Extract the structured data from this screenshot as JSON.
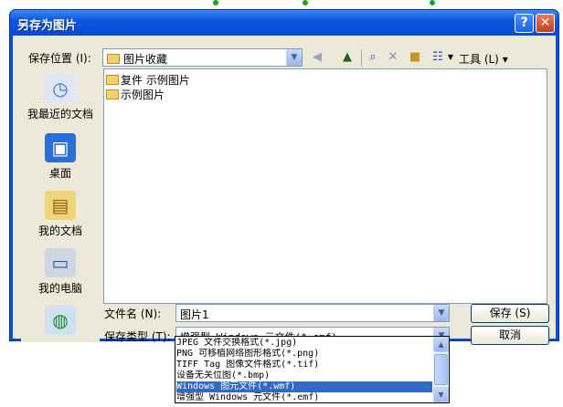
{
  "dialog": {
    "title": "另存为图片",
    "help_icon": "?",
    "close_icon": "✕"
  },
  "toolbar": {
    "save_in_label": "保存位置 (I):",
    "location": "图片收藏",
    "tools_label": "工具 (L)",
    "icons": [
      "back-icon",
      "up-folder-icon",
      "search-web-icon",
      "delete-icon",
      "new-folder-icon",
      "views-icon"
    ]
  },
  "places": [
    {
      "label": "我最近的文档",
      "icon": "recent-documents-icon"
    },
    {
      "label": "桌面",
      "icon": "desktop-icon"
    },
    {
      "label": "我的文档",
      "icon": "my-documents-icon"
    },
    {
      "label": "我的电脑",
      "icon": "my-computer-icon"
    },
    {
      "label": "",
      "icon": "network-places-icon"
    }
  ],
  "files": [
    "复件 示例图片",
    "示例图片"
  ],
  "filename": {
    "label": "文件名 (N):",
    "value": "图片1"
  },
  "filetype": {
    "label": "保存类型 (T):",
    "selected": "增强型 Windows 元文件(*.emf)",
    "options": [
      "JPEG 文件交换格式(*.jpg)",
      "PNG 可移植网络图形格式(*.png)",
      "TIFF Tag 图像文件格式(*.tif)",
      "设备无关位图(*.bmp)",
      "Windows 图元文件(*.wmf)",
      "增强型 Windows 元文件(*.emf)"
    ],
    "highlighted_index": 4
  },
  "buttons": {
    "save": "保存 (S)",
    "cancel": "取消"
  }
}
